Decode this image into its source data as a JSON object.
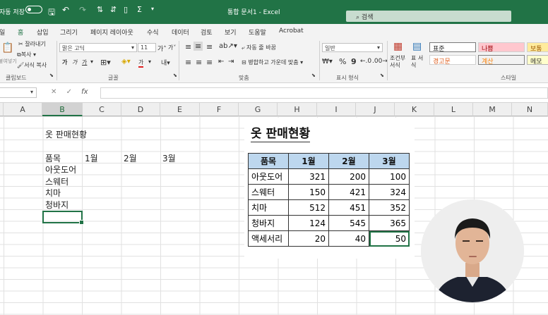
{
  "titlebar": {
    "autosave_label": "자동 저장",
    "title": "통합 문서1 - Excel",
    "search_placeholder": "검색"
  },
  "menu": {
    "tabs": [
      "일",
      "홈",
      "삽입",
      "그리기",
      "페이지 레이아웃",
      "수식",
      "데이터",
      "검토",
      "보기",
      "도움말",
      "Acrobat"
    ],
    "active_tab": "홈"
  },
  "ribbon": {
    "clipboard": {
      "cut": "잘라내기",
      "copy": "복사",
      "format_painter": "서식 복사",
      "paste": "붙여넣기",
      "label": "클립보드"
    },
    "font": {
      "name": "맑은 고딕",
      "size": "11",
      "grow": "가",
      "shrink": "가",
      "bold": "가",
      "italic": "가",
      "underline": "가",
      "font_color": "가",
      "label": "글꼴"
    },
    "alignment": {
      "wrap": "자동 줄 바꿈",
      "merge": "병합하고 가운데 맞춤",
      "label": "맞춤"
    },
    "number": {
      "format": "일반",
      "percent": "%",
      "comma": "9",
      "label": "표시 형식"
    },
    "styles": {
      "conditional": "조건부 서식",
      "as_table": "표 서식",
      "normal": "표준",
      "bad": "나쁨",
      "good": "보통",
      "warning": "경고문",
      "calc": "계산",
      "note": "메모",
      "label": "스타일"
    }
  },
  "formula_bar": {
    "fx": "fx",
    "cancel": "✕",
    "enter": "✓",
    "value": ""
  },
  "sheet": {
    "columns": [
      "A",
      "B",
      "C",
      "D",
      "E",
      "F",
      "G",
      "H",
      "I",
      "J",
      "K",
      "L",
      "M",
      "N"
    ],
    "selected_column": "B",
    "b_block": {
      "title": "옷 판매현황",
      "headers": [
        "품목",
        "1월",
        "2월",
        "3월"
      ],
      "items": [
        "아웃도어",
        "스웨터",
        "치마",
        "청바지"
      ]
    }
  },
  "card": {
    "title": "옷 판매현황",
    "headers": [
      "품목",
      "1월",
      "2월",
      "3월"
    ],
    "rows": [
      {
        "item": "아웃도어",
        "m1": "321",
        "m2": "200",
        "m3": "100"
      },
      {
        "item": "스웨터",
        "m1": "150",
        "m2": "421",
        "m3": "324"
      },
      {
        "item": "치마",
        "m1": "512",
        "m2": "451",
        "m3": "352"
      },
      {
        "item": "청바지",
        "m1": "124",
        "m2": "545",
        "m3": "365"
      },
      {
        "item": "액세서리",
        "m1": "20",
        "m2": "40",
        "m3": "50"
      }
    ]
  },
  "colors": {
    "excel_green": "#217346",
    "table_header": "#bdd7ee"
  }
}
